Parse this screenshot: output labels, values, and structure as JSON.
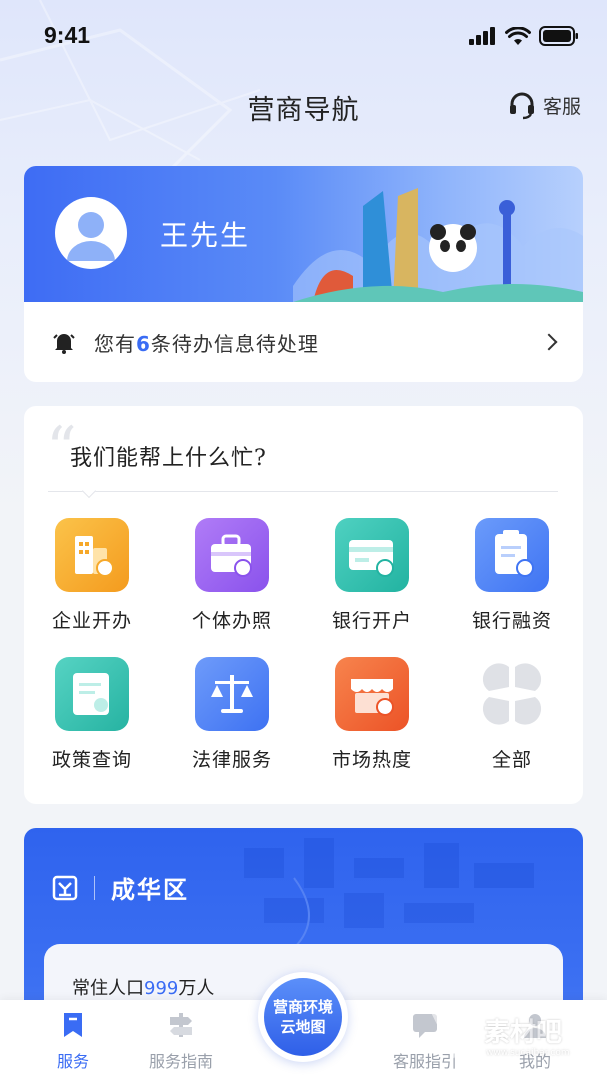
{
  "status_bar": {
    "time": "9:41"
  },
  "nav": {
    "title": "营商导航",
    "service_label": "客服"
  },
  "user": {
    "name": "王先生"
  },
  "notice": {
    "prefix": "您有",
    "count": "6",
    "suffix": "条待办信息待处理"
  },
  "help": {
    "title": "我们能帮上什么忙?",
    "items": [
      {
        "label": "企业开办",
        "icon": "building-icon",
        "color": "#f6a829"
      },
      {
        "label": "个体办照",
        "icon": "briefcase-icon",
        "color": "#9b66f2"
      },
      {
        "label": "银行开户",
        "icon": "bank-card-icon",
        "color": "#2fbfad"
      },
      {
        "label": "银行融资",
        "icon": "finance-doc-icon",
        "color": "#4f86f7"
      },
      {
        "label": "政策查询",
        "icon": "policy-doc-icon",
        "color": "#35bfae"
      },
      {
        "label": "法律服务",
        "icon": "scales-icon",
        "color": "#4d82f6"
      },
      {
        "label": "市场热度",
        "icon": "market-store-icon",
        "color": "#f2673a"
      },
      {
        "label": "全部",
        "icon": "all-grid-icon",
        "color": "#dfe1e6"
      }
    ]
  },
  "map": {
    "district": "成华区",
    "population_prefix": "常住人口",
    "population_value": "999",
    "population_unit": "万人"
  },
  "tab_bar": {
    "tabs": [
      {
        "label": "服务",
        "active": true
      },
      {
        "label": "服务指南",
        "active": false
      },
      {
        "label": "客服指引",
        "active": false
      },
      {
        "label": "我的",
        "active": false
      }
    ],
    "center_line1": "营商环境",
    "center_line2": "云地图"
  },
  "watermark": {
    "text": "素材吧",
    "url": "www.sucaibar.com"
  }
}
